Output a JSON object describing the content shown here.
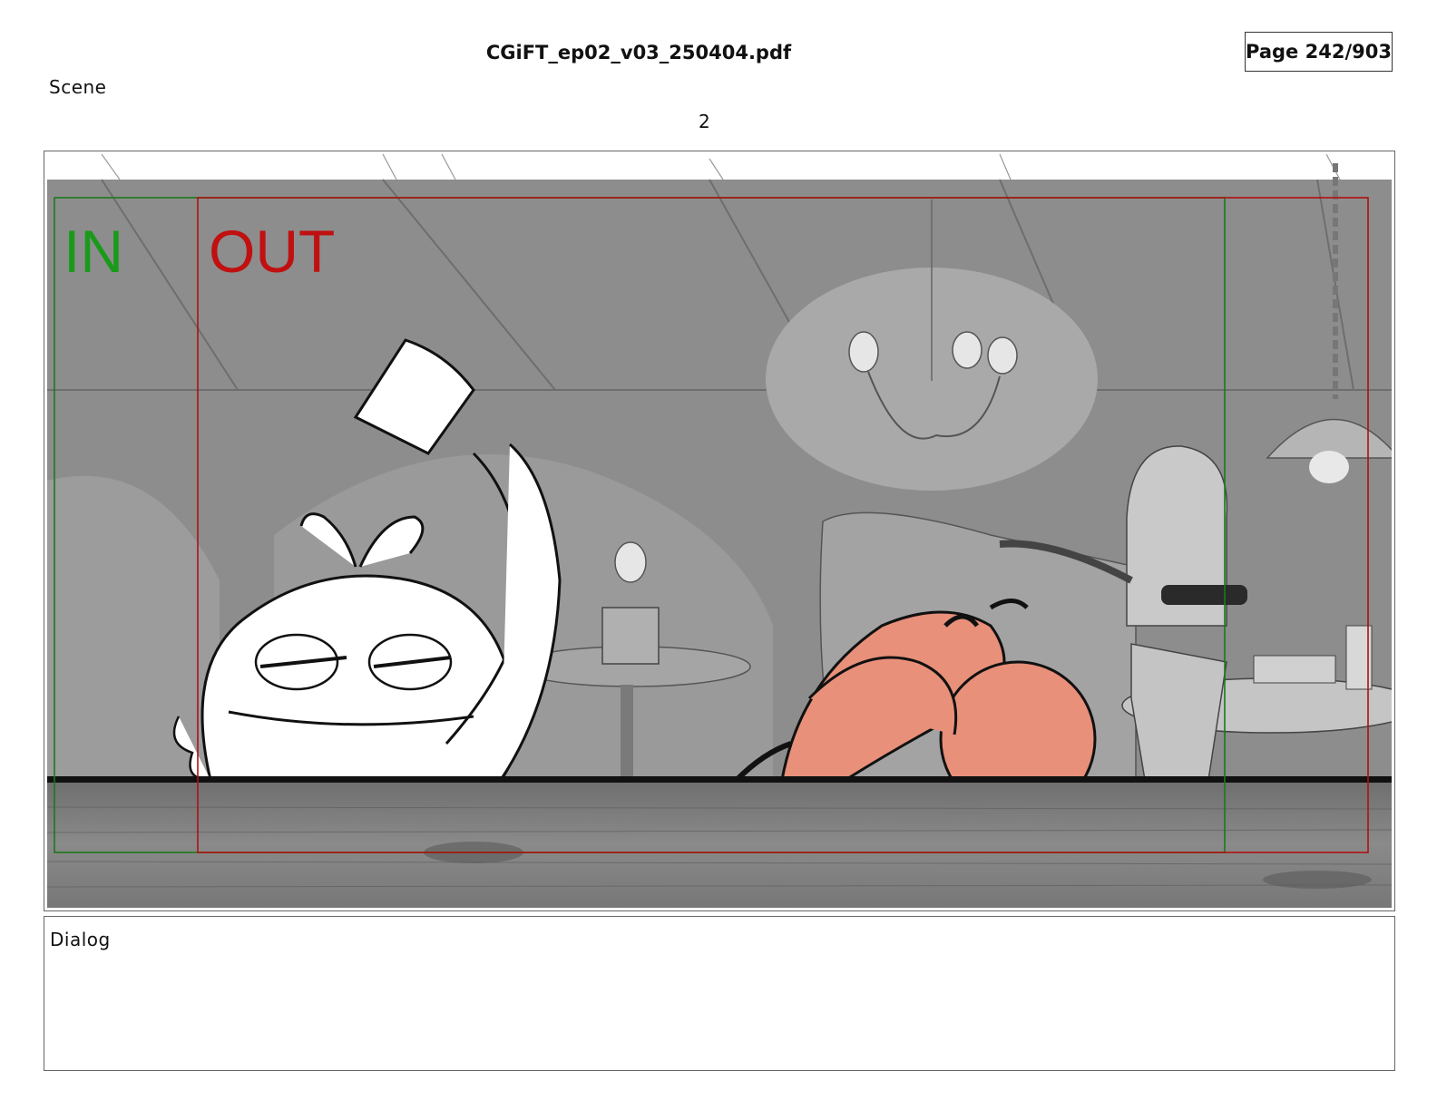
{
  "header": {
    "file_name": "CGiFT_ep02_v03_250404.pdf",
    "page_indicator": "Page 242/903"
  },
  "scene": {
    "label": "Scene",
    "number": "2"
  },
  "panel": {
    "in_marker": "IN",
    "out_marker": "OUT",
    "in_color": "#1a9a1a",
    "out_color": "#c01010",
    "background_tone": "#8c8c8c",
    "character_accent": "#e8907a"
  },
  "dialog": {
    "label": "Dialog"
  }
}
